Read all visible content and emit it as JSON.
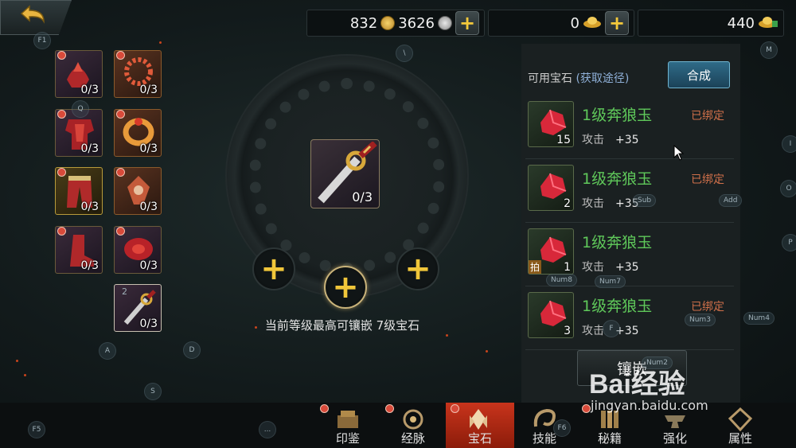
{
  "currency": {
    "gold": "832",
    "silver": "3626",
    "ingot": "0",
    "bound_ingot": "440"
  },
  "equipment_slots": [
    {
      "count": "0/3"
    },
    {
      "count": "0/3"
    },
    {
      "count": "0/3"
    },
    {
      "count": "0/3"
    },
    {
      "count": "0/3"
    },
    {
      "count": "0/3"
    },
    {
      "count": "0/3"
    },
    {
      "count": "0/3"
    },
    {
      "count": "0/3"
    }
  ],
  "center": {
    "item_count": "0/3",
    "hint": "当前等级最高可镶嵌 7级宝石"
  },
  "panel": {
    "title": "可用宝石",
    "link": "(获取途径)",
    "synth_label": "合成",
    "inlay_label": "镶嵌",
    "gems": [
      {
        "name": "1级奔狼玉",
        "bound": "已绑定",
        "stat_name": "攻击",
        "stat_value": "+35",
        "count": "15",
        "tag": ""
      },
      {
        "name": "1级奔狼玉",
        "bound": "已绑定",
        "stat_name": "攻击",
        "stat_value": "+35",
        "count": "2",
        "tag": ""
      },
      {
        "name": "1级奔狼玉",
        "bound": "",
        "stat_name": "攻击",
        "stat_value": "+35",
        "count": "1",
        "tag": "拍"
      },
      {
        "name": "1级奔狼玉",
        "bound": "已绑定",
        "stat_name": "攻击",
        "stat_value": "+35",
        "count": "3",
        "tag": ""
      }
    ]
  },
  "nav": [
    {
      "label": "印鉴"
    },
    {
      "label": "经脉"
    },
    {
      "label": "宝石"
    },
    {
      "label": "技能"
    },
    {
      "label": "秘籍"
    },
    {
      "label": "强化"
    },
    {
      "label": "属性"
    }
  ],
  "keys": {
    "f1": "F1",
    "q": "Q",
    "backslash": "\\",
    "m": "M",
    "i": "I",
    "o": "O",
    "p": "P",
    "sub": "Sub",
    "add": "Add",
    "num8": "Num8",
    "num7": "Num7",
    "num3": "Num3",
    "num4": "Num4",
    "f": "F",
    "num2": "Num2",
    "a": "A",
    "d": "D",
    "s": "S",
    "f5": "F5",
    "dots": "...",
    "f6": "F6",
    "two": "2"
  },
  "watermark": {
    "brand": "Bai经验",
    "url": "jingyan.baidu.com"
  }
}
